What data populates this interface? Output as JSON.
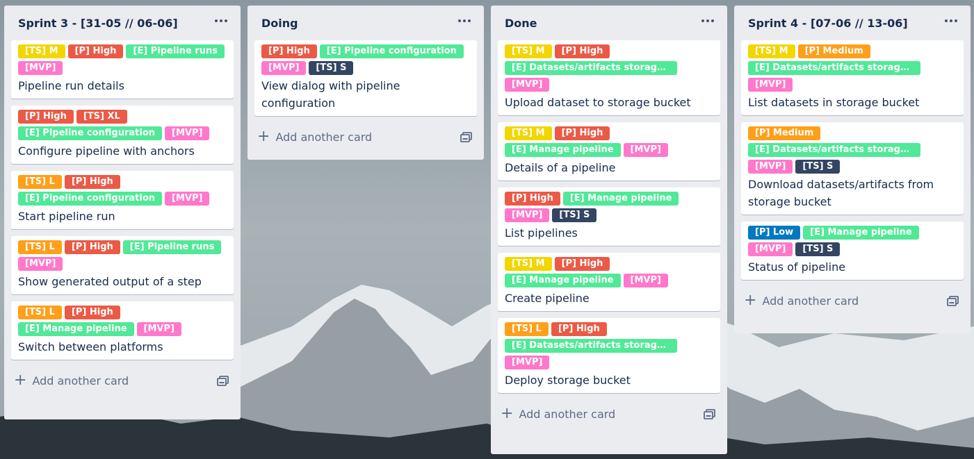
{
  "colors": {
    "TS_yellow": "#f2d600",
    "TS_orange": "#ff9f1a",
    "TS_dark": "#344563",
    "P_red": "#eb5a46",
    "P_orange": "#ff9f1a",
    "P_blue": "#0079bf",
    "E_green": "#61bd4f",
    "E_lightgreen": "#51e898",
    "MVP_pink": "#ff78cb"
  },
  "icons": {
    "menu": "horizontal-dots-icon",
    "add": "plus-icon",
    "template": "card-template-icon"
  },
  "lists": [
    {
      "title": "Sprint 3 - [31-05 // 06-06]",
      "add_label": "Add another card",
      "cards": [
        {
          "labels": [
            {
              "text": "[TS] M",
              "color": "#f2d600"
            },
            {
              "text": "[P] High",
              "color": "#eb5a46"
            },
            {
              "text": "[E] Pipeline runs",
              "color": "#51e898"
            },
            {
              "text": "[MVP]",
              "color": "#ff78cb"
            }
          ],
          "title": "Pipeline run details"
        },
        {
          "labels": [
            {
              "text": "[P] High",
              "color": "#eb5a46"
            },
            {
              "text": "[TS] XL",
              "color": "#eb5a46"
            },
            {
              "text": "[E] Pipeline configuration",
              "color": "#51e898"
            },
            {
              "text": "[MVP]",
              "color": "#ff78cb"
            }
          ],
          "title": "Configure pipeline with anchors"
        },
        {
          "labels": [
            {
              "text": "[TS] L",
              "color": "#ff9f1a"
            },
            {
              "text": "[P] High",
              "color": "#eb5a46"
            },
            {
              "text": "[E] Pipeline configuration",
              "color": "#51e898"
            },
            {
              "text": "[MVP]",
              "color": "#ff78cb"
            }
          ],
          "title": "Start pipeline run"
        },
        {
          "labels": [
            {
              "text": "[TS] L",
              "color": "#ff9f1a"
            },
            {
              "text": "[P] High",
              "color": "#eb5a46"
            },
            {
              "text": "[E] Pipeline runs",
              "color": "#51e898"
            },
            {
              "text": "[MVP]",
              "color": "#ff78cb"
            }
          ],
          "title": "Show generated output of a step"
        },
        {
          "labels": [
            {
              "text": "[TS] L",
              "color": "#ff9f1a"
            },
            {
              "text": "[P] High",
              "color": "#eb5a46"
            },
            {
              "text": "[E] Manage pipeline",
              "color": "#51e898"
            },
            {
              "text": "[MVP]",
              "color": "#ff78cb"
            }
          ],
          "title": "Switch between platforms"
        }
      ]
    },
    {
      "title": "Doing",
      "add_label": "Add another card",
      "cards": [
        {
          "labels": [
            {
              "text": "[P] High",
              "color": "#eb5a46"
            },
            {
              "text": "[E] Pipeline configuration",
              "color": "#51e898"
            },
            {
              "text": "[MVP]",
              "color": "#ff78cb"
            },
            {
              "text": "[TS] S",
              "color": "#344563"
            }
          ],
          "title": "View dialog with pipeline configuration"
        }
      ]
    },
    {
      "title": "Done",
      "add_label": "Add another card",
      "cards": [
        {
          "labels": [
            {
              "text": "[TS] M",
              "color": "#f2d600"
            },
            {
              "text": "[P] High",
              "color": "#eb5a46"
            },
            {
              "text": "[E] Datasets/artifacts storage bu...",
              "color": "#51e898"
            },
            {
              "text": "[MVP]",
              "color": "#ff78cb"
            }
          ],
          "title": "Upload dataset to storage bucket"
        },
        {
          "labels": [
            {
              "text": "[TS] M",
              "color": "#f2d600"
            },
            {
              "text": "[P] High",
              "color": "#eb5a46"
            },
            {
              "text": "[E] Manage pipeline",
              "color": "#51e898"
            },
            {
              "text": "[MVP]",
              "color": "#ff78cb"
            }
          ],
          "title": "Details of a pipeline"
        },
        {
          "labels": [
            {
              "text": "[P] High",
              "color": "#eb5a46"
            },
            {
              "text": "[E] Manage pipeline",
              "color": "#51e898"
            },
            {
              "text": "[MVP]",
              "color": "#ff78cb"
            },
            {
              "text": "[TS] S",
              "color": "#344563"
            }
          ],
          "title": "List pipelines"
        },
        {
          "labels": [
            {
              "text": "[TS] M",
              "color": "#f2d600"
            },
            {
              "text": "[P] High",
              "color": "#eb5a46"
            },
            {
              "text": "[E] Manage pipeline",
              "color": "#51e898"
            },
            {
              "text": "[MVP]",
              "color": "#ff78cb"
            }
          ],
          "title": "Create pipeline"
        },
        {
          "labels": [
            {
              "text": "[TS] L",
              "color": "#ff9f1a"
            },
            {
              "text": "[P] High",
              "color": "#eb5a46"
            },
            {
              "text": "[E] Datasets/artifacts storage bu...",
              "color": "#51e898"
            },
            {
              "text": "[MVP]",
              "color": "#ff78cb"
            }
          ],
          "title": "Deploy storage bucket"
        }
      ]
    },
    {
      "title": "Sprint 4 - [07-06 // 13-06]",
      "add_label": "Add another card",
      "cards": [
        {
          "labels": [
            {
              "text": "[TS] M",
              "color": "#f2d600"
            },
            {
              "text": "[P] Medium",
              "color": "#ff9f1a"
            },
            {
              "text": "[E] Datasets/artifacts storage bu...",
              "color": "#51e898"
            },
            {
              "text": "[MVP]",
              "color": "#ff78cb"
            }
          ],
          "title": "List datasets in storage bucket"
        },
        {
          "labels": [
            {
              "text": "[P] Medium",
              "color": "#ff9f1a"
            },
            {
              "text": "[E] Datasets/artifacts storage bu...",
              "color": "#51e898"
            },
            {
              "text": "[MVP]",
              "color": "#ff78cb"
            },
            {
              "text": "[TS] S",
              "color": "#344563"
            }
          ],
          "title": "Download datasets/artifacts from storage bucket"
        },
        {
          "labels": [
            {
              "text": "[P] Low",
              "color": "#0079bf"
            },
            {
              "text": "[E] Manage pipeline",
              "color": "#51e898"
            },
            {
              "text": "[MVP]",
              "color": "#ff78cb"
            },
            {
              "text": "[TS] S",
              "color": "#344563"
            }
          ],
          "title": "Status of pipeline"
        }
      ]
    }
  ]
}
